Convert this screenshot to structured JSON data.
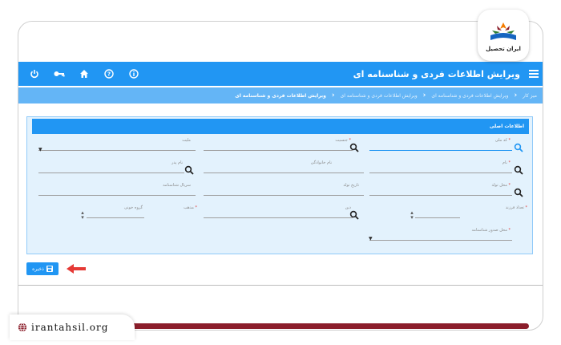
{
  "brand": {
    "logo_text": "ایران تحصیل",
    "site_url": "irantahsil.org"
  },
  "topbar": {
    "title": "ویرایش اطلاعات فردی و شناسنامه ای",
    "icons": [
      "info-icon",
      "help-icon",
      "home-icon",
      "key-icon",
      "power-icon"
    ]
  },
  "breadcrumbs": [
    "میز کار",
    "ویرایش اطلاعات فردی و شناسنامه ای",
    "ویرایش اطلاعات فردی و شناسنامه ای",
    "ویرایش اطلاعات فردی و شناسنامه ای"
  ],
  "panel": {
    "title": "اطلاعات اصلی"
  },
  "fields": {
    "national_code": "کد ملی",
    "gender": "جنسیت",
    "nationality": "ملیت",
    "first_name": "نام",
    "last_name": "نام خانوادگی",
    "father_name": "نام پدر",
    "birth_place": "محل تولد",
    "birth_date": "تاریخ تولد",
    "religion": "دین",
    "marital": "وضعیت تاهل",
    "child_count": "تعداد فرزند",
    "serial": "سریال شناسنامه",
    "blood": "گروه خونی",
    "sect": "مذهب",
    "birth_cert_place": "محل صدور شناسنامه"
  },
  "save_button": {
    "label": "ذخیره"
  },
  "colors": {
    "primary": "#2196f3",
    "crumb": "#64b5f6",
    "panel": "#e3f2fd",
    "brand_red": "#8b1e2b",
    "arrow": "#e53935"
  }
}
